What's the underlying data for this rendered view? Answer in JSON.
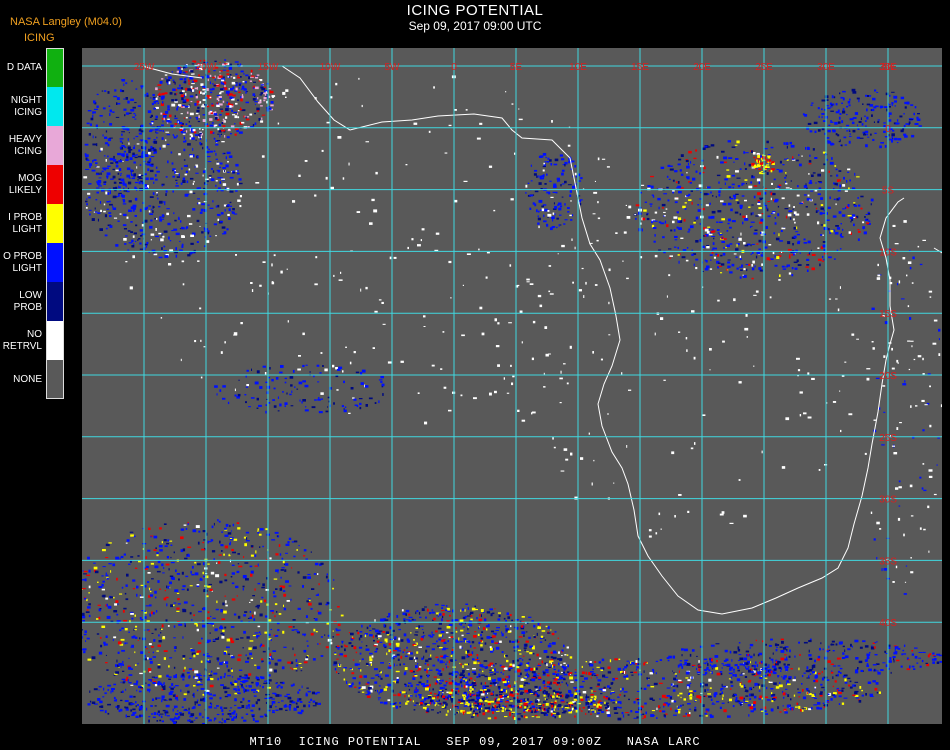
{
  "header": {
    "source": "NASA Langley (M04.0)",
    "product": "ICING",
    "title": "ICING POTENTIAL",
    "date": "Sep 09, 2017 09:00 UTC"
  },
  "legend": [
    {
      "line1": "D DATA",
      "line2": "",
      "color": "#10b010"
    },
    {
      "line1": "NIGHT",
      "line2": "ICING",
      "color": "#00e8ee"
    },
    {
      "line1": "HEAVY",
      "line2": "ICING",
      "color": "#e8a8d8"
    },
    {
      "line1": "MOG",
      "line2": "LIKELY",
      "color": "#ee0000"
    },
    {
      "line1": "I PROB",
      "line2": "LIGHT",
      "color": "#ffff00"
    },
    {
      "line1": "O PROB",
      "line2": "LIGHT",
      "color": "#0010ff"
    },
    {
      "line1": "LOW",
      "line2": "PROB",
      "color": "#000a80"
    },
    {
      "line1": "NO",
      "line2": "RETRVL",
      "color": "#ffffff"
    },
    {
      "line1": "NONE",
      "line2": "",
      "color": "#595959"
    }
  ],
  "map": {
    "background_color": "#595959",
    "grid_color": "#40d8e0",
    "coast_color": "#ffffff",
    "lon_labels": [
      "25W",
      "20W",
      "15W",
      "10W",
      "5W",
      "0",
      "5E",
      "10E",
      "15E",
      "20E",
      "25E",
      "30E",
      "35E"
    ],
    "lat_labels": [
      "5N",
      "0",
      "5S",
      "10S",
      "15S",
      "20S",
      "25S",
      "30S",
      "35S",
      "40S"
    ]
  },
  "footer": "MT10  ICING POTENTIAL   SEP 09, 2017 09:00Z   NASA LARC"
}
